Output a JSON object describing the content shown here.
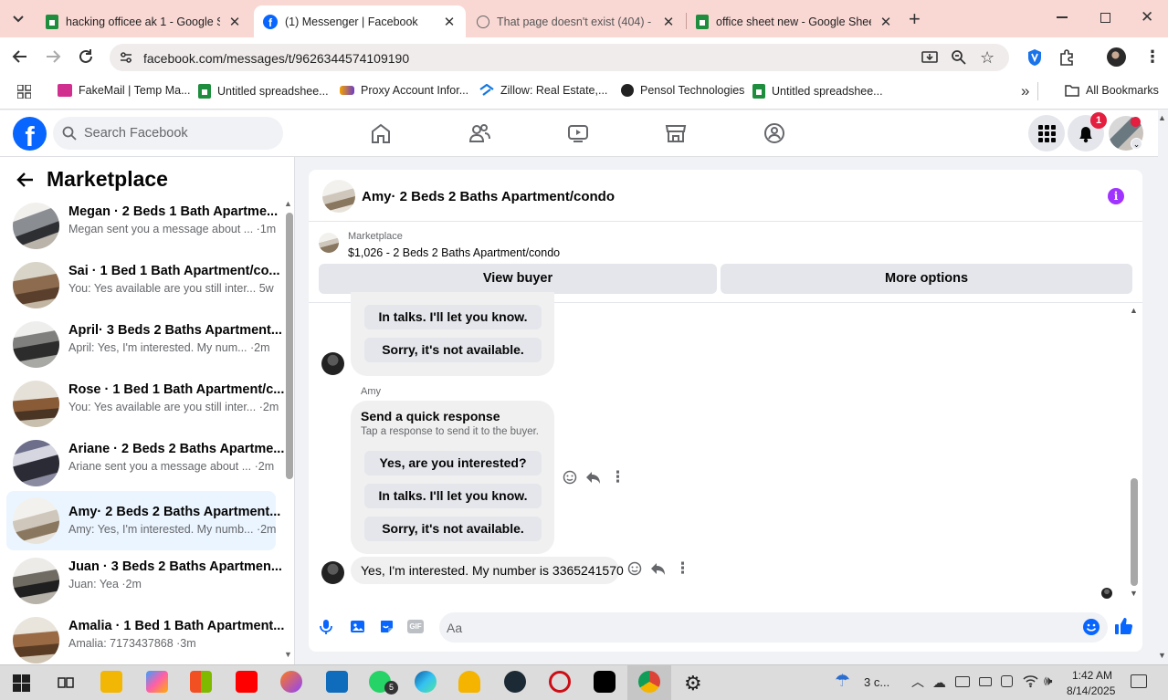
{
  "browser": {
    "tabs": [
      {
        "title": "hacking officee ak 1 - Google Sh",
        "icon": "google-sheets-icon",
        "active": false
      },
      {
        "title": "(1) Messenger | Facebook",
        "icon": "facebook-icon",
        "active": true
      },
      {
        "title": "That page doesn't exist (404) - I",
        "icon": "globe-icon",
        "active": false
      },
      {
        "title": "office sheet new - Google Shee",
        "icon": "google-sheets-icon",
        "active": false
      }
    ],
    "url": "facebook.com/messages/t/9626344574109190",
    "bookmarks": [
      "FakeMail | Temp Ma...",
      "Untitled spreadshee...",
      "Proxy Account Infor...",
      "Zillow: Real Estate,...",
      "Pensol Technologies",
      "Untitled spreadshee..."
    ],
    "all_bookmarks": "All Bookmarks"
  },
  "facebook": {
    "logo": "f",
    "search_placeholder": "Search Facebook",
    "notification_count": "1"
  },
  "sidebar": {
    "title": "Marketplace",
    "conversations": [
      {
        "name": "Megan · 2 Beds 1 Bath Apartme...",
        "preview": "Megan sent you a message about ... ·1m",
        "selected": false
      },
      {
        "name": "Sai · 1 Bed 1 Bath Apartment/co...",
        "preview": "You: Yes available are you still inter... 5w",
        "selected": false
      },
      {
        "name": "April· 3 Beds 2 Baths Apartment...",
        "preview": "April: Yes, I'm interested. My num... ·2m",
        "selected": false
      },
      {
        "name": "Rose · 1 Bed 1 Bath Apartment/c...",
        "preview": "You: Yes available are you still inter... ·2m",
        "selected": false
      },
      {
        "name": "Ariane · 2 Beds 2 Baths Apartme...",
        "preview": "Ariane sent you a message about ... ·2m",
        "selected": false
      },
      {
        "name": "Amy· 2 Beds 2 Baths Apartment...",
        "preview": "Amy: Yes, I'm interested. My numb... ·2m",
        "selected": true
      },
      {
        "name": "Juan · 3 Beds 2 Baths Apartmen...",
        "preview": "Juan: Yea ·2m",
        "selected": false
      },
      {
        "name": "Amalia · 1 Bed 1 Bath Apartment...",
        "preview": "Amalia: 7173437868 ·3m",
        "selected": false
      }
    ]
  },
  "chat": {
    "title": "Amy· 2 Beds 2 Baths Apartment/condo",
    "listing": {
      "source": "Marketplace",
      "text": "$1,026 - 2 Beds 2 Baths Apartment/condo"
    },
    "view_buyer": "View buyer",
    "more_options": "More options",
    "top_card": {
      "replies": [
        "In talks. I'll let you know.",
        "Sorry, it's not available."
      ]
    },
    "sender": "Amy",
    "quick_card": {
      "title": "Send a quick response",
      "subtitle": "Tap a response to send it to the buyer.",
      "replies": [
        "Yes, are you interested?",
        "In talks. I'll let you know.",
        "Sorry, it's not available."
      ]
    },
    "last_message": "Yes, I'm interested. My number is 3365241570",
    "composer_placeholder": "Aa"
  },
  "taskbar": {
    "weather": "3 c...",
    "time": "1:42 AM",
    "date": "8/14/2025",
    "whatsapp_badge": "5"
  },
  "colors": {
    "tabbar": "#f9d8d4",
    "facebook_blue": "#0866ff",
    "selected_conversation": "#ebf5ff",
    "notification_red": "#e41e3f",
    "info_purple": "#a033ff"
  }
}
